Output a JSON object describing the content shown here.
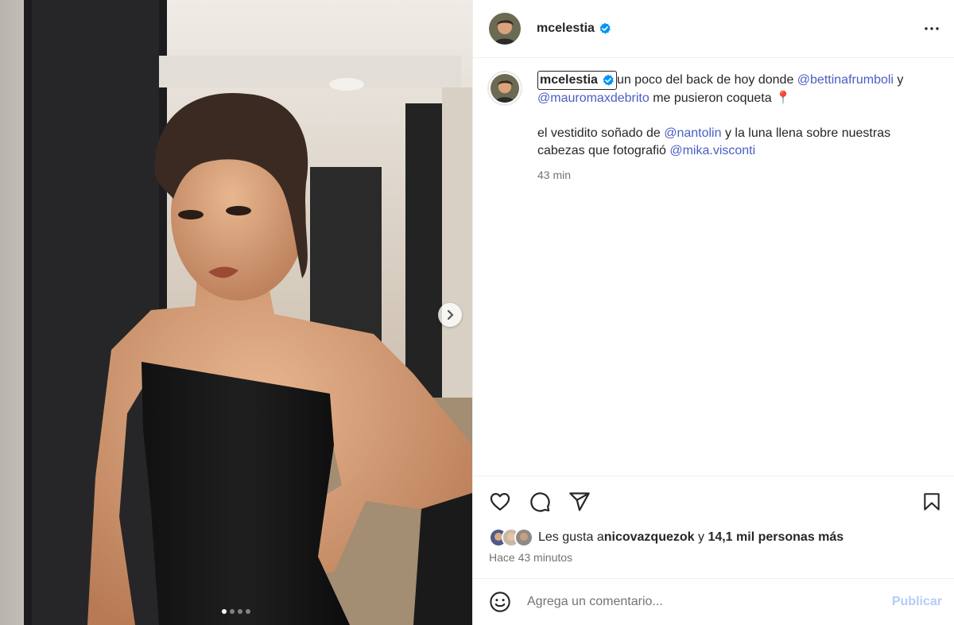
{
  "post": {
    "username": "mcelestia",
    "verified": true
  },
  "caption": {
    "username": "mcelestia",
    "line1_text": "un poco del back de hoy donde ",
    "mention1": "@bettinafrumboli",
    "line1_tail": " y",
    "mention2": "@mauromaxdebrito",
    "line2_text": " me pusieron coqueta",
    "emoji": "📍",
    "para2_text": "el vestidito soñado de ",
    "mention3": "@nantolin",
    "para2_mid": " y la luna llena sobre nuestras cabezas que fotografió ",
    "mention4": "@mika.visconti",
    "time": "43 min"
  },
  "likes": {
    "prefix": "Les gusta a ",
    "user": "nicovazquezok",
    "connector": " y ",
    "others": "14,1 mil personas más"
  },
  "timestamp": "Hace 43 minutos",
  "comment": {
    "placeholder": "Agrega un comentario...",
    "publish_label": "Publicar"
  },
  "carousel": {
    "total_slides": 4,
    "current_slide": 1
  },
  "colors": {
    "mention": "#4a5ec4",
    "verified": "#0095f6",
    "publish_disabled": "#b3cdf5"
  },
  "icons": {
    "like": "heart-icon",
    "comment": "comment-icon",
    "share": "share-icon",
    "save": "bookmark-icon",
    "more": "more-options-icon",
    "emoji": "emoji-icon",
    "next": "chevron-right-icon"
  }
}
